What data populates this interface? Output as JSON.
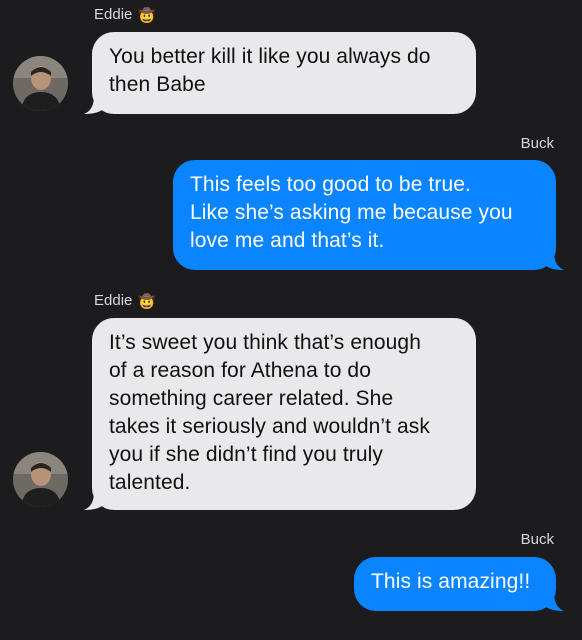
{
  "conversation": {
    "messages": [
      {
        "sender": "Eddie",
        "sender_emoji": "🤠",
        "direction": "incoming",
        "lines": [
          "You better kill it like you always do",
          "then Babe"
        ]
      },
      {
        "sender": "Buck",
        "direction": "outgoing",
        "lines": [
          "This feels too good to be true.",
          "Like she’s asking me because you",
          "love me and that’s it."
        ]
      },
      {
        "sender": "Eddie",
        "sender_emoji": "🤠",
        "direction": "incoming",
        "lines": [
          "It’s sweet you think that’s enough",
          "of a reason for Athena to do",
          "something career related. She",
          "takes it seriously and wouldn’t ask",
          "you if she didn’t find you truly",
          "talented."
        ]
      },
      {
        "sender": "Buck",
        "direction": "outgoing",
        "lines": [
          "This is amazing!!"
        ]
      }
    ]
  },
  "colors": {
    "background": "#1c1c1e",
    "incoming_bubble": "#e9e9eb",
    "outgoing_bubble": "#0b84ff",
    "sender_label": "#d7d7dc"
  },
  "icons": {
    "avatar": "eddie-avatar-photo",
    "sender_emoji": "cowboy-emoji"
  }
}
